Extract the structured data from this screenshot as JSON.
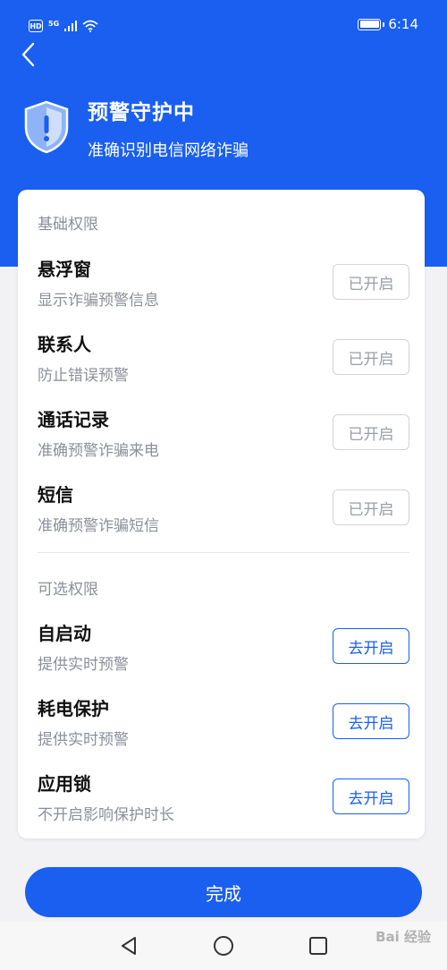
{
  "status_bar": {
    "hd": "HD",
    "network": "5G",
    "time": "6:14",
    "battery_level": 1.0
  },
  "header": {
    "title": "预警守护中",
    "subtitle": "准确识别电信网络诈骗"
  },
  "basic_section": {
    "title": "基础权限",
    "items": [
      {
        "name": "悬浮窗",
        "desc": "显示诈骗预警信息",
        "button": "已开启"
      },
      {
        "name": "联系人",
        "desc": "防止错误预警",
        "button": "已开启"
      },
      {
        "name": "通话记录",
        "desc": "准确预警诈骗来电",
        "button": "已开启"
      },
      {
        "name": "短信",
        "desc": "准确预警诈骗短信",
        "button": "已开启"
      }
    ]
  },
  "optional_section": {
    "title": "可选权限",
    "items": [
      {
        "name": "自启动",
        "desc": "提供实时预警",
        "button": "去开启"
      },
      {
        "name": "耗电保护",
        "desc": "提供实时预警",
        "button": "去开启"
      },
      {
        "name": "应用锁",
        "desc": "不开启影响保护时长",
        "button": "去开启"
      }
    ]
  },
  "done_button": "完成",
  "watermark": "Bai 经验",
  "colors": {
    "primary": "#1a5ff0",
    "background": "#f2f2f4",
    "muted_text": "#8b8f99"
  },
  "icons": {
    "back": "chevron-left-icon",
    "shield": "shield-alert-icon",
    "nav_back": "triangle-back-icon",
    "nav_home": "circle-home-icon",
    "nav_recent": "square-recent-icon"
  }
}
